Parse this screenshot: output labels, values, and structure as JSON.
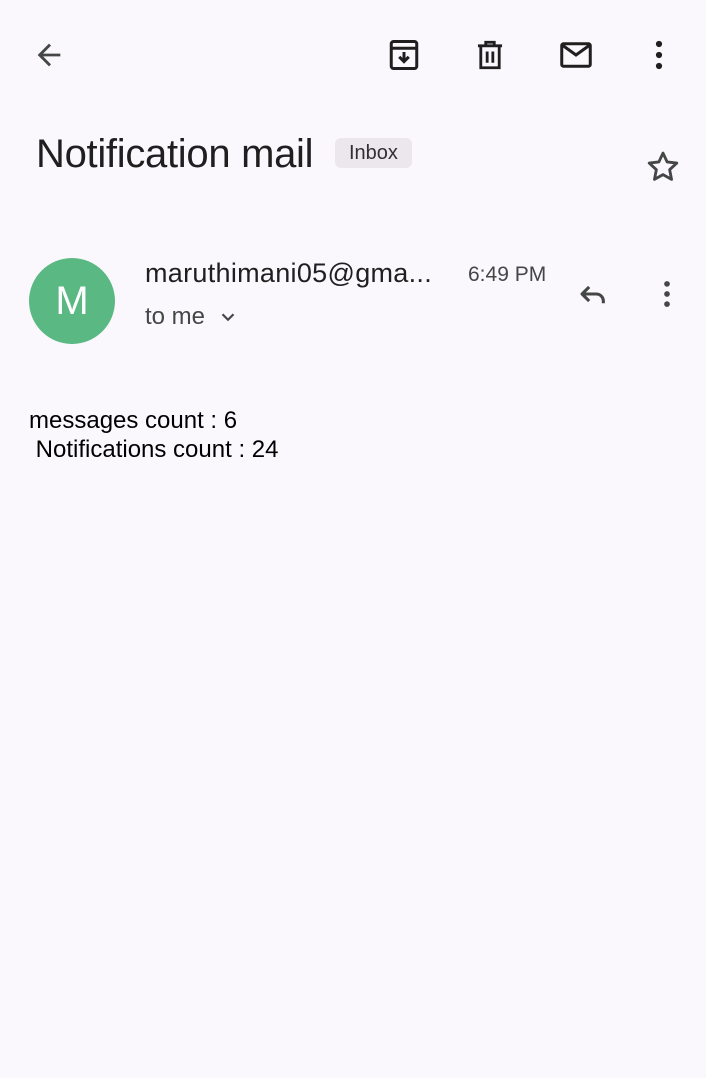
{
  "toolbar": {
    "back_icon": "arrow-back-icon",
    "archive_icon": "archive-icon",
    "delete_icon": "delete-icon",
    "unread_icon": "mail-icon",
    "more_icon": "more-vert-icon"
  },
  "email": {
    "subject": "Notification mail",
    "label": "Inbox",
    "star_icon": "star-outline-icon",
    "sender": {
      "initial": "M",
      "name": "maruthimani05@gma...",
      "avatar_color": "#5ab983"
    },
    "time": "6:49 PM",
    "recipient": "to me",
    "recipient_toggle_icon": "chevron-down-icon",
    "reply_icon": "reply-icon",
    "message_more_icon": "more-vert-icon",
    "body_lines": [
      "messages count : 6",
      " Notifications count : 24"
    ]
  },
  "colors": {
    "background": "#fbf8fd",
    "chip_background": "#ebe7ec",
    "text_primary": "#1f1f1f",
    "text_secondary": "#444746"
  }
}
